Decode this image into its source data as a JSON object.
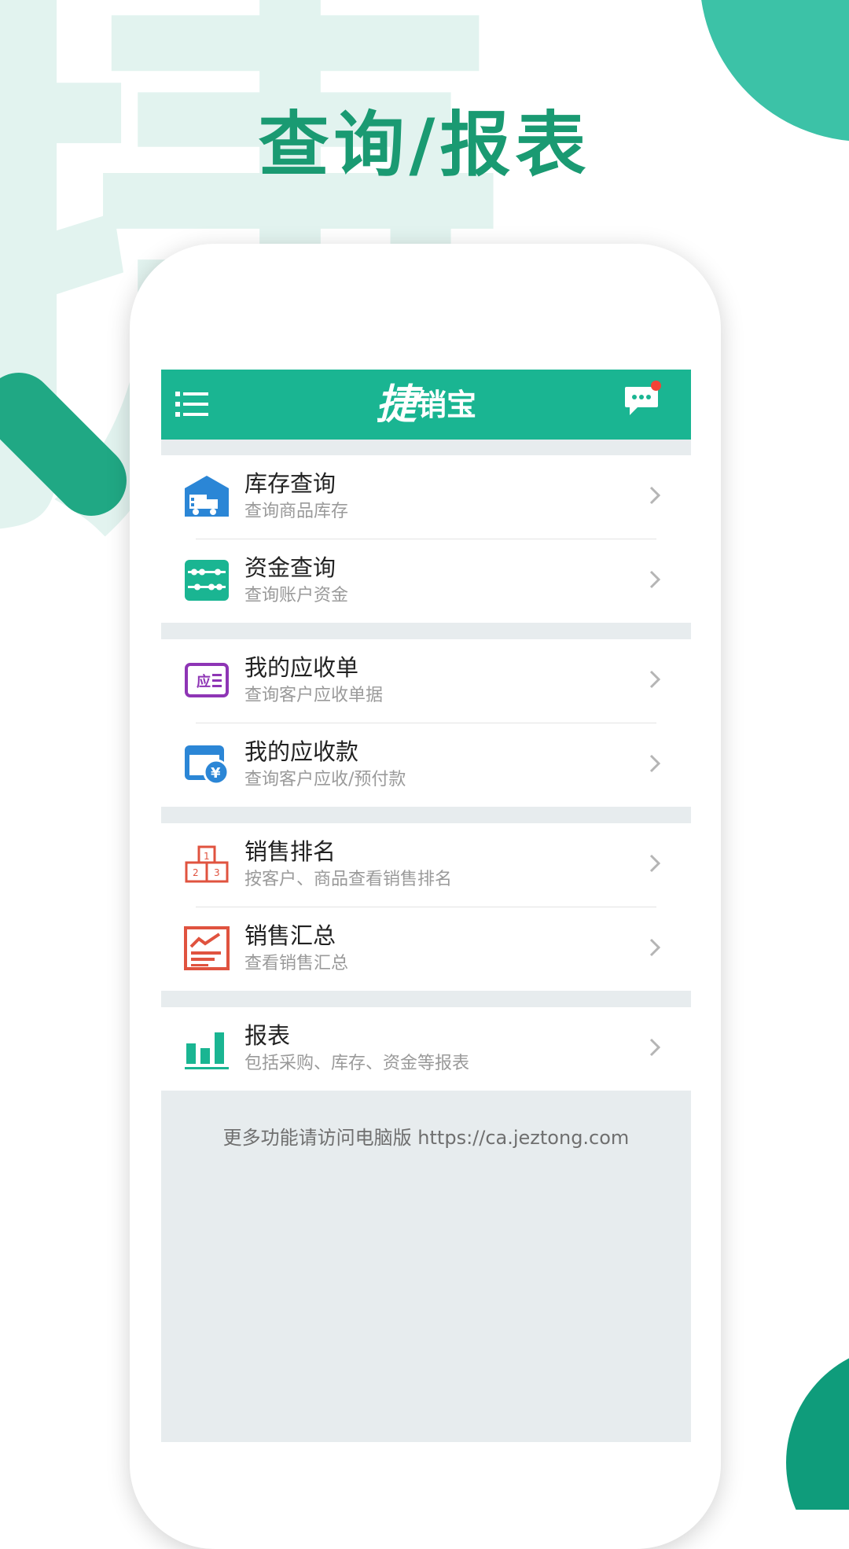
{
  "headline": "查询/报表",
  "app": {
    "logo_main": "捷",
    "logo_sub": "销宝"
  },
  "menu_groups": [
    {
      "items": [
        {
          "title": "库存查询",
          "subtitle": "查询商品库存",
          "icon": "warehouse-icon",
          "color": "#2b86d6"
        },
        {
          "title": "资金查询",
          "subtitle": "查询账户资金",
          "icon": "abacus-icon",
          "color": "#1ab592"
        }
      ]
    },
    {
      "items": [
        {
          "title": "我的应收单",
          "subtitle": "查询客户应收单据",
          "icon": "receivable-doc-icon",
          "color": "#8e35b5"
        },
        {
          "title": "我的应收款",
          "subtitle": "查询客户应收/预付款",
          "icon": "receivable-money-icon",
          "color": "#2b86d6"
        }
      ]
    },
    {
      "items": [
        {
          "title": "销售排名",
          "subtitle": "按客户、商品查看销售排名",
          "icon": "ranking-podium-icon",
          "color": "#e0533f"
        },
        {
          "title": "销售汇总",
          "subtitle": "查看销售汇总",
          "icon": "sales-summary-icon",
          "color": "#e0533f"
        }
      ]
    },
    {
      "items": [
        {
          "title": "报表",
          "subtitle": "包括采购、库存、资金等报表",
          "icon": "bar-chart-icon",
          "color": "#1ab592"
        }
      ]
    }
  ],
  "footer": "更多功能请访问电脑版 https://ca.jeztong.com",
  "colors": {
    "brand": "#1ab592",
    "headline": "#1a9a72",
    "unread_dot": "#f44336"
  }
}
